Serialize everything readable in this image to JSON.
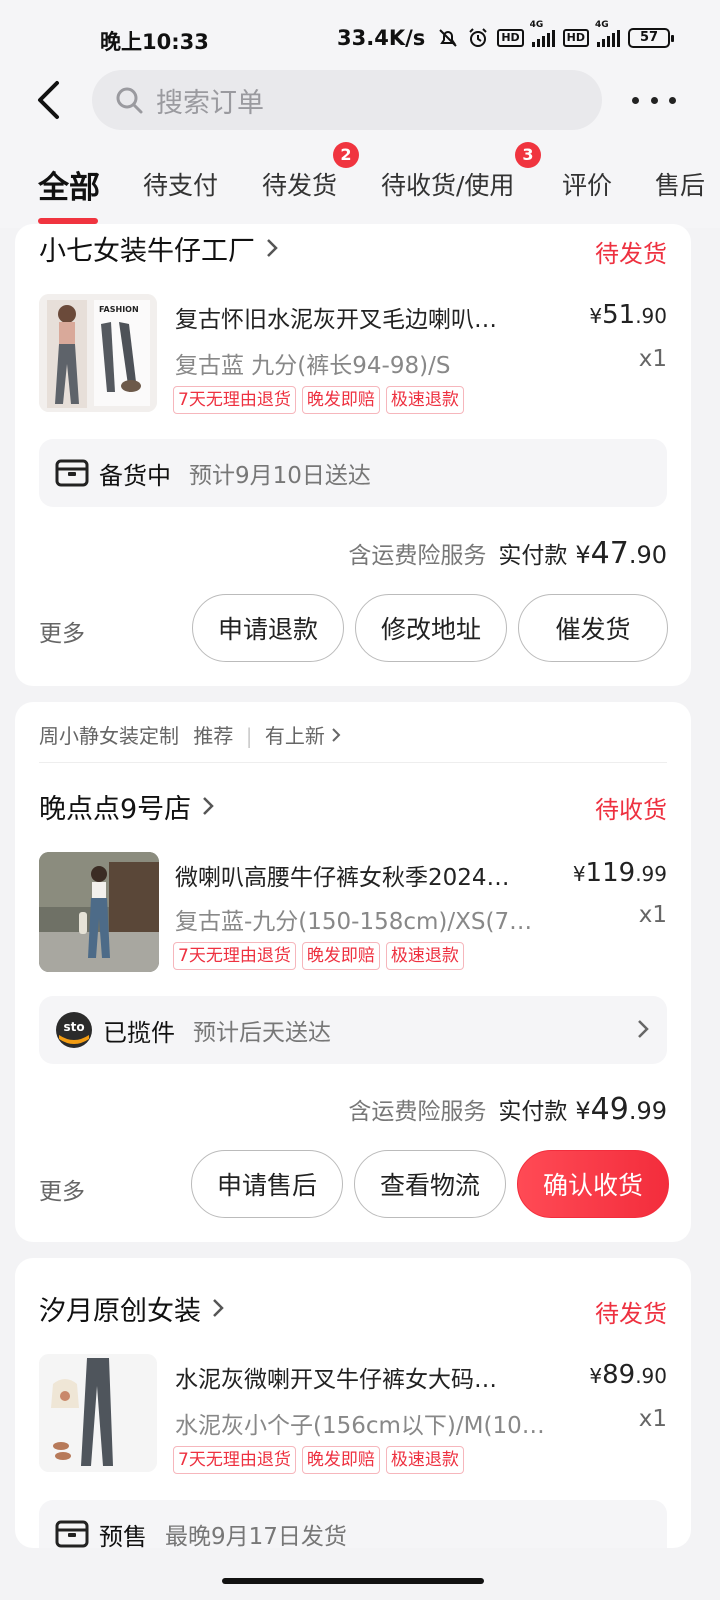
{
  "status_bar": {
    "time": "晚上10:33",
    "speed": "33.4K/s",
    "battery": "57"
  },
  "header": {
    "search_placeholder": "搜索订单"
  },
  "tabs": [
    {
      "label": "全部"
    },
    {
      "label": "待支付"
    },
    {
      "label": "待发货",
      "badge": "2"
    },
    {
      "label": "待收货/使用",
      "badge": "3"
    },
    {
      "label": "评价"
    },
    {
      "label": "售后"
    }
  ],
  "orders": [
    {
      "shop": "小七女装牛仔工厂",
      "status": "待发货",
      "product": {
        "title": "复古怀旧水泥灰开叉毛边喇叭…",
        "spec": "复古蓝  九分(裤长94-98)/S",
        "price_symbol": "¥",
        "price_int": "51",
        "price_dec": ".90",
        "qty": "x1",
        "thumb_text": "FASHION",
        "tags": [
          "7天无理由退货",
          "晚发即赔",
          "极速退款"
        ]
      },
      "logistics": {
        "status": "备货中",
        "eta": "预计9月10日送达",
        "icon": "box-icon"
      },
      "total": {
        "note": "含运费险服务",
        "label": "实付款",
        "symbol": "¥",
        "int": "47",
        "dec": ".90"
      },
      "more": "更多",
      "buttons": [
        "申请退款",
        "修改地址",
        "催发货"
      ]
    },
    {
      "recommend": {
        "shop": "周小静女装定制",
        "tag": "推荐",
        "link": "有上新"
      },
      "shop": "晚点点9号店",
      "status": "待收货",
      "product": {
        "title": "微喇叭高腰牛仔裤女秋季2024…",
        "spec": "复古蓝-九分(150-158cm)/XS(7…",
        "price_symbol": "¥",
        "price_int": "119",
        "price_dec": ".99",
        "qty": "x1",
        "tags": [
          "7天无理由退货",
          "晚发即赔",
          "极速退款"
        ]
      },
      "logistics": {
        "status": "已揽件",
        "eta": "预计后天送达",
        "icon": "sto-express-icon",
        "logo_text": "sto"
      },
      "total": {
        "note": "含运费险服务",
        "label": "实付款",
        "symbol": "¥",
        "int": "49",
        "dec": ".99"
      },
      "more": "更多",
      "buttons": [
        "申请售后",
        "查看物流",
        "确认收货"
      ]
    },
    {
      "shop": "汐月原创女装",
      "status": "待发货",
      "product": {
        "title": "水泥灰微喇开叉牛仔裤女大码…",
        "spec": "水泥灰小个子(156cm以下)/M(10…",
        "price_symbol": "¥",
        "price_int": "89",
        "price_dec": ".90",
        "qty": "x1",
        "tags": [
          "7天无理由退货",
          "晚发即赔",
          "极速退款"
        ]
      },
      "logistics": {
        "status": "预售",
        "eta": "最晚9月17日发货",
        "icon": "box-icon"
      }
    }
  ],
  "colors": {
    "accent": "#f0343f",
    "background": "#f3f3f5"
  }
}
